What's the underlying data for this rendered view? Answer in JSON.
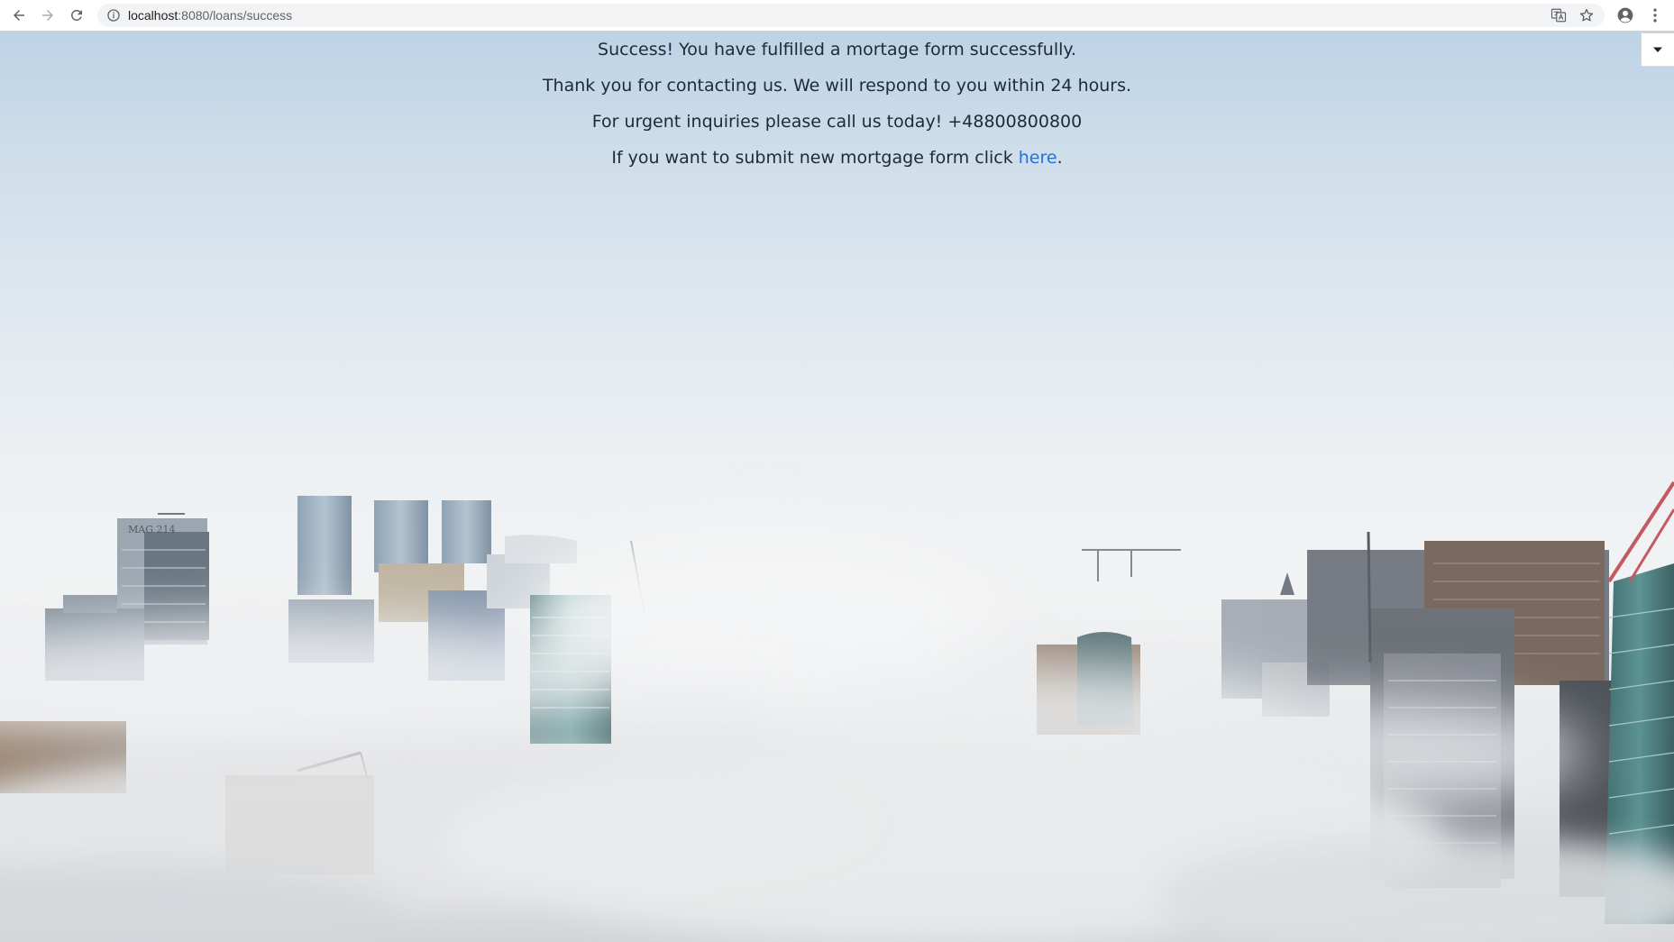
{
  "browser": {
    "url_host": "localhost",
    "url_rest": ":8080/loans/success"
  },
  "page": {
    "line1": "Success! You have fulfilled a mortage form successfully.",
    "line2": "Thank you for contacting us. We will respond to you within 24 hours.",
    "line3": "For urgent inquiries please call us today! +48800800800",
    "line4_prefix": "If you want to submit new mortgage form click ",
    "line4_link": "here",
    "line4_suffix": "."
  },
  "background": {
    "building_sign": "MAG 214"
  },
  "icons": {
    "back": "arrow-left-icon",
    "forward": "arrow-right-icon",
    "reload": "reload-icon",
    "site_info": "info-icon",
    "translate": "translate-icon",
    "bookmark": "star-icon",
    "profile": "account-circle-icon",
    "menu": "kebab-menu-icon",
    "toggle": "caret-down-icon"
  },
  "colors": {
    "link": "#1a73e8",
    "text": "#1f2a36",
    "sky_top": "#bdd3e6"
  }
}
